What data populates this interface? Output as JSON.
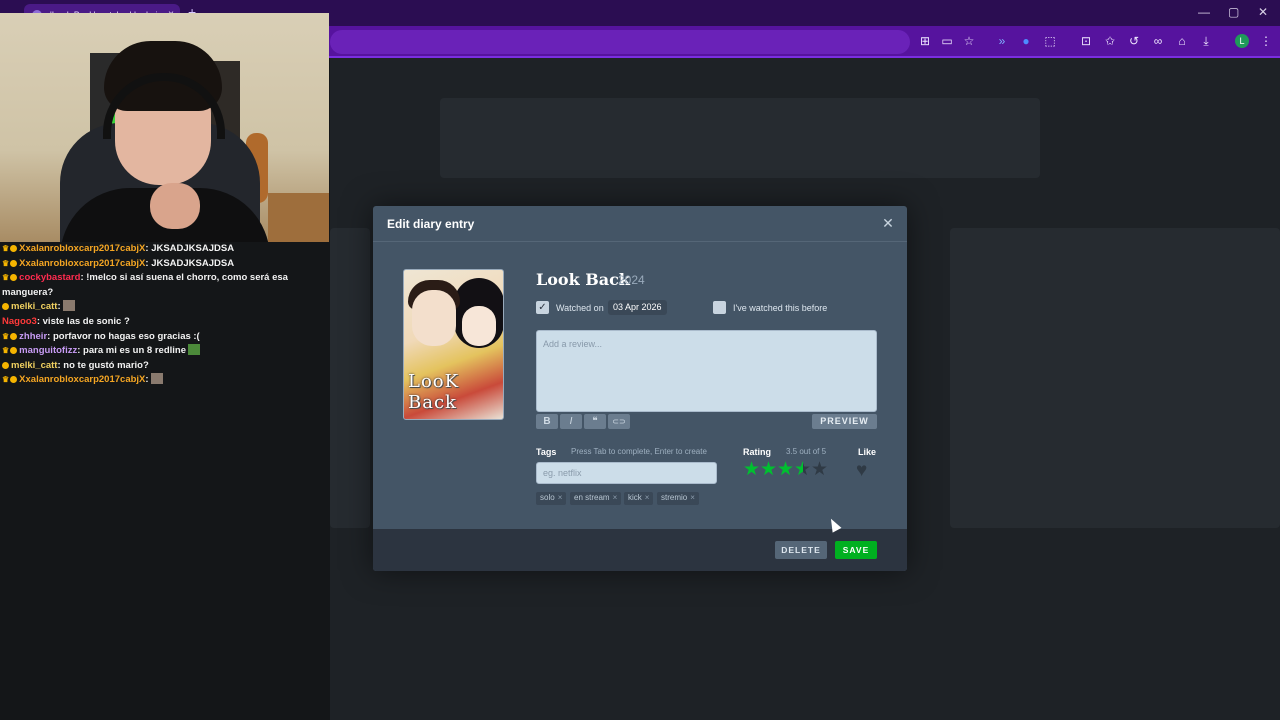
{
  "browser": {
    "tab_title": "'Look Back' watched by kei...",
    "tab_close": "×",
    "new_tab": "+",
    "window_controls": [
      "—",
      "▢",
      "✕"
    ],
    "toolbar_icons": [
      "translate-icon",
      "cast-icon",
      "star-icon",
      "extension-icon",
      "extension-icon",
      "puzzle-icon",
      "history-icon",
      "bookmark-icon",
      "downloads-icon",
      "menu-icon"
    ],
    "profile_initial": "L",
    "colors": {
      "tabbar": "#2b0d52",
      "toolbar": "#56139e"
    }
  },
  "chat": {
    "messages": [
      {
        "user": "Xxalanrobloxcarp2017cabjX",
        "user_color": "#f5a623",
        "text": ": JKSADJKSAJDSA",
        "badges": "crown-badge"
      },
      {
        "user": "Xxalanrobloxcarp2017cabjX",
        "user_color": "#f5a623",
        "text": ": JKSADJKSAJDSA",
        "badges": "crown-badge"
      },
      {
        "user": "cockybastard",
        "user_color": "#ff2b4f",
        "text": ": !melco si así suena el chorro, como será esa",
        "badges": "crown-badge"
      },
      {
        "user": "",
        "user_color": "#ffffff",
        "text": "manguera?",
        "badges": ""
      },
      {
        "user": "melki_catt",
        "user_color": "#f0d060",
        "text": ":",
        "badges": "sub-badge",
        "emote": true
      },
      {
        "user": "Nagoo3",
        "user_color": "#ff3a3a",
        "text": ": viste las de sonic ?",
        "badges": ""
      },
      {
        "user": "zhheir",
        "user_color": "#c89cf5",
        "text": ": porfavor no hagas eso gracias :(",
        "badges": "crown-badge"
      },
      {
        "user": "manguitofizz",
        "user_color": "#c89cf5",
        "text": ": para mi es un 8 redline",
        "badges": "crown-badge",
        "emote": true
      },
      {
        "user": "melki_catt",
        "user_color": "#f0d060",
        "text": ": no te gustó mario?",
        "badges": "sub-badge"
      },
      {
        "user": "Xxalanrobloxcarp2017cabjX",
        "user_color": "#f5a623",
        "text": ":",
        "badges": "crown-badge",
        "emote": true
      }
    ]
  },
  "modal": {
    "title": "Edit diary entry",
    "close_icon": "✕",
    "poster_title": "LooK Back",
    "film_title": "Look Back",
    "film_year": "2024",
    "watched_on_label": "Watched on",
    "watched_on_checked": true,
    "watched_date": "03 Apr 2026",
    "rewatch_label": "I've watched this before",
    "rewatch_checked": false,
    "review_placeholder": "Add a review...",
    "format_buttons": [
      "B",
      "I",
      "❝",
      "⊂⊃"
    ],
    "preview_label": "PREVIEW",
    "tags_label": "Tags",
    "tags_hint": "Press Tab to complete, Enter to create",
    "tags_placeholder": "eg. netflix",
    "tags": [
      "solo",
      "en stream",
      "kick",
      "stremio"
    ],
    "tag_remove": "×",
    "rating_label": "Rating",
    "rating_text": "3.5 out of 5",
    "rating_value": 3.5,
    "rating_max": 5,
    "like_label": "Like",
    "liked": false,
    "delete_label": "DELETE",
    "save_label": "SAVE",
    "colors": {
      "star_active": "#00c030",
      "star_inactive": "#2f3a45",
      "save": "#00b020"
    }
  }
}
